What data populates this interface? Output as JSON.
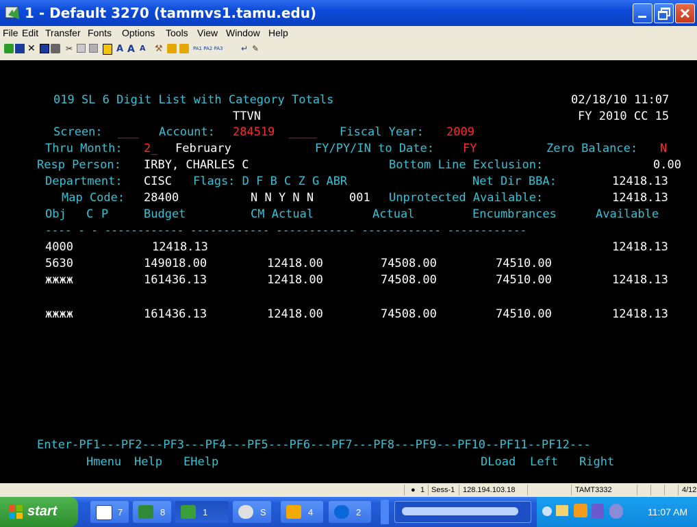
{
  "window": {
    "title": "1 - Default 3270 (tammvs1.tamu.edu)"
  },
  "menu": [
    "File",
    "Edit",
    "Transfer",
    "Fonts",
    "Options",
    "Tools",
    "View",
    "Window",
    "Help"
  ],
  "toolbar": {
    "icons": [
      "new-session-icon",
      "keyboard-icon",
      "disconnect-icon",
      "save-icon",
      "print-icon",
      "cut-icon",
      "copy-icon",
      "paste-icon",
      "select-icon",
      "font-large-icon",
      "font-increase-icon",
      "font-decrease-icon",
      "tools-icon",
      "send-file-icon",
      "receive-file-icon"
    ],
    "pa_keys": "PA1 PA2 PA3"
  },
  "terminal": {
    "screen_title": "019 SL 6 Digit List with Category Totals",
    "datetime": "02/18/10 11:07",
    "subtitle": "TTVN",
    "fy_cc": "FY 2010 CC 15",
    "screen_label": "Screen:",
    "screen_value": "___",
    "account_label": "Account:",
    "account_value": "284519",
    "account_blank": "____",
    "fiscal_year_label": "Fiscal Year:",
    "fiscal_year_value": "2009",
    "thru_month_label": "Thru Month:",
    "thru_month_value": "2_",
    "thru_month_name": "February",
    "fy_py_label": "FY/PY/IN to Date:",
    "fy_py_value": "FY",
    "zero_balance_label": "Zero Balance:",
    "zero_balance_value": "N",
    "resp_person_label": "Resp Person:",
    "resp_person_value": "IRBY, CHARLES C",
    "bottom_line_label": "Bottom Line Exclusion:",
    "bottom_line_value": "0.00",
    "department_label": "Department:",
    "department_value": "CISC",
    "flags_label": "Flags: D F B C Z G ABR",
    "net_dir_label": "Net Dir BBA:",
    "net_dir_value": "12418.13",
    "map_code_label": "Map Code:",
    "map_code_value": "28400",
    "flags_values": "N N Y N N",
    "abr_value": "001",
    "unprotected_label": "Unprotected Available:",
    "unprotected_value": "12418.13",
    "columns": {
      "obj": "Obj",
      "c": "C",
      "p": "P",
      "budget": "Budget",
      "cm_actual": "CM Actual",
      "actual": "Actual",
      "encumbrances": "Encumbrances",
      "available": "Available"
    },
    "divider": "---- - - ------------ ------------ ------------ ------------ ------------",
    "rows": [
      {
        "obj": "4000",
        "budget": "12418.13",
        "cm_actual": "",
        "actual": "",
        "encumbrances": "",
        "available": "12418.13"
      },
      {
        "obj": "5630",
        "budget": "149018.00",
        "cm_actual": "12418.00",
        "actual": "74508.00",
        "encumbrances": "74510.00",
        "available": ""
      },
      {
        "obj": "жжжж",
        "budget": "161436.13",
        "cm_actual": "12418.00",
        "actual": "74508.00",
        "encumbrances": "74510.00",
        "available": "12418.13"
      }
    ],
    "total_row": {
      "obj": "жжжж",
      "budget": "161436.13",
      "cm_actual": "12418.00",
      "actual": "74508.00",
      "encumbrances": "74510.00",
      "available": "12418.13"
    },
    "pf_line": "Enter-PF1---PF2---PF3---PF4---PF5---PF6---PF7---PF8---PF9---PF10--PF11--PF12---",
    "pf_labels": {
      "hmenu": "Hmenu",
      "help": "Help",
      "ehelp": "EHelp",
      "dload": "DLoad",
      "left": "Left",
      "right": "Right"
    }
  },
  "statusbar": {
    "session_num": "1",
    "session": "Sess-1",
    "ip": "128.194.103.18",
    "lu": "TAMT3332",
    "cursor": "4/12"
  },
  "taskbar": {
    "start_label": "start",
    "tasks": [
      {
        "label": "7",
        "icon": "word-icon"
      },
      {
        "label": "8",
        "icon": "excel-icon"
      },
      {
        "label": "1",
        "icon": "terminal-icon"
      },
      {
        "label": "S",
        "icon": "app-icon"
      },
      {
        "label": "4",
        "icon": "outlook-icon"
      },
      {
        "label": "2",
        "icon": "ie-icon"
      }
    ],
    "clock": "11:07 AM"
  }
}
